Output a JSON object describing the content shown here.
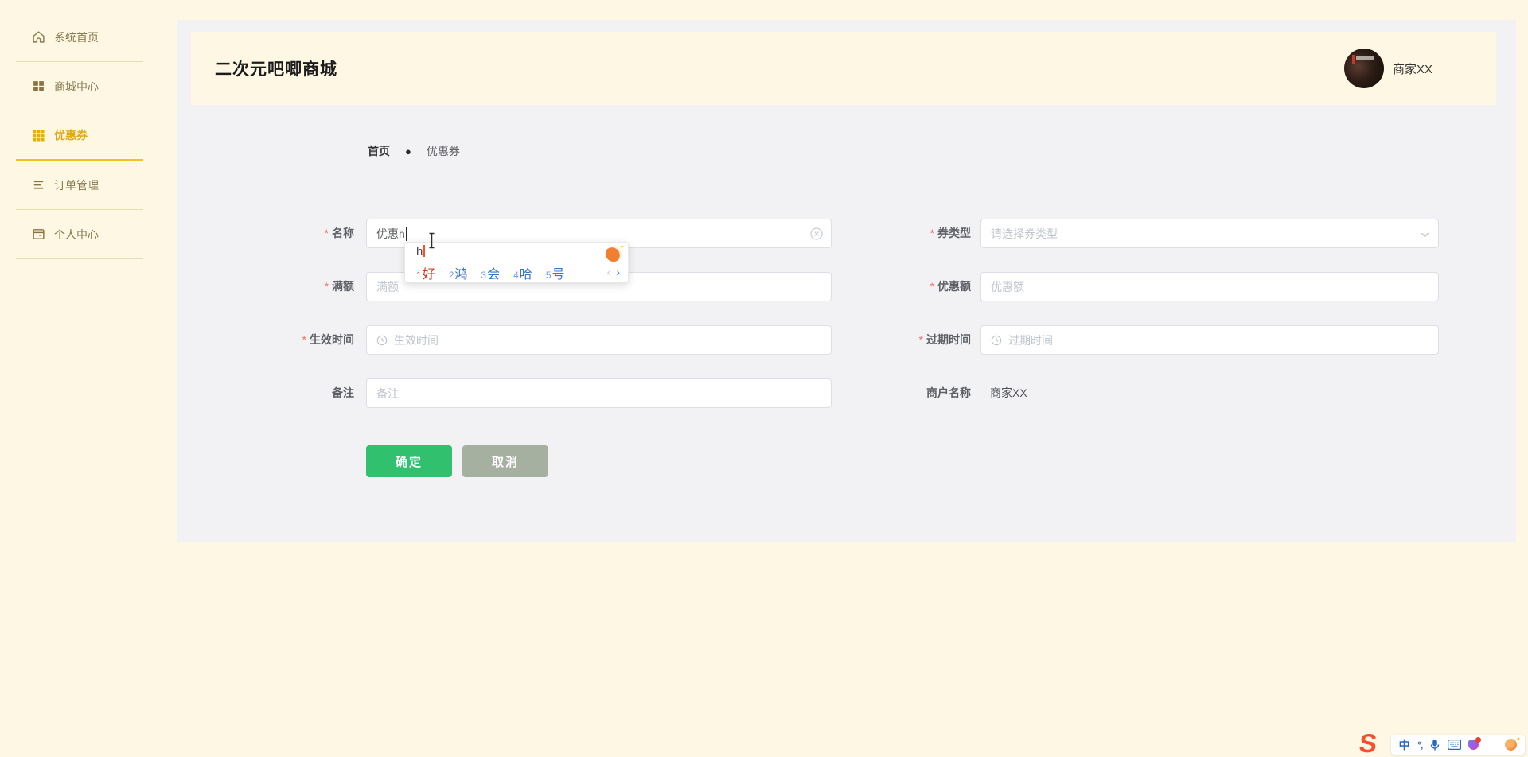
{
  "sidebar": {
    "items": [
      {
        "label": "系统首页",
        "icon": "home-icon",
        "active": false
      },
      {
        "label": "商城中心",
        "icon": "grid-2x2-icon",
        "active": false
      },
      {
        "label": "优惠券",
        "icon": "grid-3x3-icon",
        "active": true
      },
      {
        "label": "订单管理",
        "icon": "list-icon",
        "active": false
      },
      {
        "label": "个人中心",
        "icon": "card-icon",
        "active": false
      }
    ]
  },
  "header": {
    "title": "二次元吧唧商城",
    "merchant_name": "商家XX"
  },
  "breadcrumb": {
    "home": "首页",
    "separator": "●",
    "current": "优惠券"
  },
  "form": {
    "required_marker": "*",
    "name": {
      "label": "名称",
      "required": true,
      "value": "优惠h"
    },
    "coupon_type": {
      "label": "券类型",
      "required": true,
      "placeholder": "请选择券类型"
    },
    "min_amount": {
      "label": "满额",
      "required": true,
      "placeholder": "满额"
    },
    "discount_amount": {
      "label": "优惠额",
      "required": true,
      "placeholder": "优惠额"
    },
    "effective_time": {
      "label": "生效时间",
      "required": true,
      "placeholder": "生效时间"
    },
    "expire_time": {
      "label": "过期时间",
      "required": true,
      "placeholder": "过期时间"
    },
    "remark": {
      "label": "备注",
      "required": false,
      "placeholder": "备注"
    },
    "merchant": {
      "label": "商户名称",
      "value": "商家XX"
    },
    "confirm_label": "确定",
    "cancel_label": "取消"
  },
  "ime": {
    "pinyin": "h",
    "candidates": [
      {
        "index": "1",
        "char": "好",
        "selected": true
      },
      {
        "index": "2",
        "char": "鸿",
        "selected": false
      },
      {
        "index": "3",
        "char": "会",
        "selected": false
      },
      {
        "index": "4",
        "char": "哈",
        "selected": false
      },
      {
        "index": "5",
        "char": "号",
        "selected": false
      }
    ],
    "prev_arrow": "‹",
    "next_arrow": "›"
  },
  "ime_toolbar": {
    "logo": "S",
    "mode_label": "中",
    "punctuation_label": "°,",
    "icons": [
      "sogou-logo-icon",
      "chinese-mode-icon",
      "punctuation-icon",
      "microphone-icon",
      "keyboard-icon",
      "skin-icon",
      "toolbox-icon",
      "emoji-icon"
    ]
  },
  "colors": {
    "page_bg": "#fdf7e4",
    "panel_bg": "#f2f2f4",
    "accent_gold": "#dfa80c",
    "active_divider": "#f2c223",
    "confirm_green": "#31c06d",
    "cancel_gray": "#a6b0a0",
    "required_red": "#f56c6c",
    "candidate_red": "#d73a22",
    "candidate_blue": "#3a76c8",
    "toolbar_blue": "#2866c8",
    "sogou_orange": "#f4502a"
  }
}
